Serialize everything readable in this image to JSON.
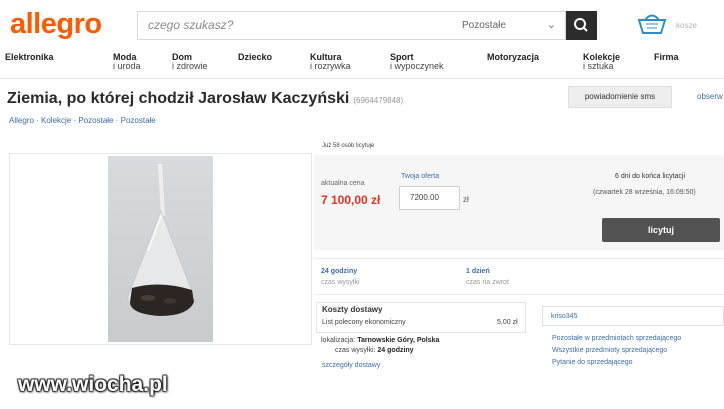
{
  "header": {
    "logo": "allegro",
    "search_placeholder": "czego szukasz?",
    "category_select": "Pozostałe",
    "category_chevron": "⌄",
    "user_text": "kosze",
    "icons": {
      "search": "search-icon",
      "basket": "basket-icon"
    }
  },
  "nav": {
    "items": [
      {
        "line1": "Elektronika",
        "line2": ""
      },
      {
        "line1": "Moda",
        "line2": "i uroda"
      },
      {
        "line1": "Dom",
        "line2": "i zdrowie"
      },
      {
        "line1": "Dziecko",
        "line2": ""
      },
      {
        "line1": "Kultura",
        "line2": "i rozrywka"
      },
      {
        "line1": "Sport",
        "line2": "i wypoczynek"
      },
      {
        "line1": "Motoryzacja",
        "line2": ""
      },
      {
        "line1": "Kolekcje",
        "line2": "i sztuka"
      },
      {
        "line1": "Firma",
        "line2": ""
      }
    ]
  },
  "item": {
    "title": "Ziemia, po której chodził Jarosław Kaczyński",
    "number": "(6964479848)",
    "notify_button": "powiadomienie sms",
    "observe_link": "obserw",
    "breadcrumb": [
      "Allegro",
      "Kolekcje",
      "Pozostałe",
      "Pozostałe"
    ]
  },
  "auction": {
    "buyers_info": "Już 58 osób licytuje",
    "current_price_label": "aktualna cena",
    "current_price": "7 100,00 zł",
    "offer_label": "Twoja oferta",
    "offer_value": "7200.00",
    "currency": "zł",
    "time_left": "6 dni do końca licytacji",
    "end_date": "(czwartek 28 września, 16:09:50)",
    "bid_button": "licytuj"
  },
  "delivery": {
    "ship_time": "24 godziny",
    "ship_time_label": "czas wysyłki",
    "return_time": "1 dzień",
    "return_time_label": "czas na zwrot",
    "costs_header": "Koszty dostawy",
    "method": "List polecony ekonomiczny",
    "method_price": "5,00 zł",
    "location_label": "lokalizacja:",
    "location": "Tarnowskie Góry, Polska",
    "send_time_label": "czas wysyłki:",
    "send_time": "24 godziny",
    "details_link": "szczegóły dostawy"
  },
  "seller": {
    "name": "kriso345",
    "links": [
      "Pozostałe w przedmiotach sprzedającego",
      "Wszystkie przedmioty sprzedającego",
      "Pytanie do sprzedającego"
    ]
  },
  "watermark": "www.wiocha.pl",
  "colors": {
    "brand": "#ff5a00",
    "price": "#e4341f",
    "link": "#3a6ea5",
    "bid_button": "#525252"
  }
}
